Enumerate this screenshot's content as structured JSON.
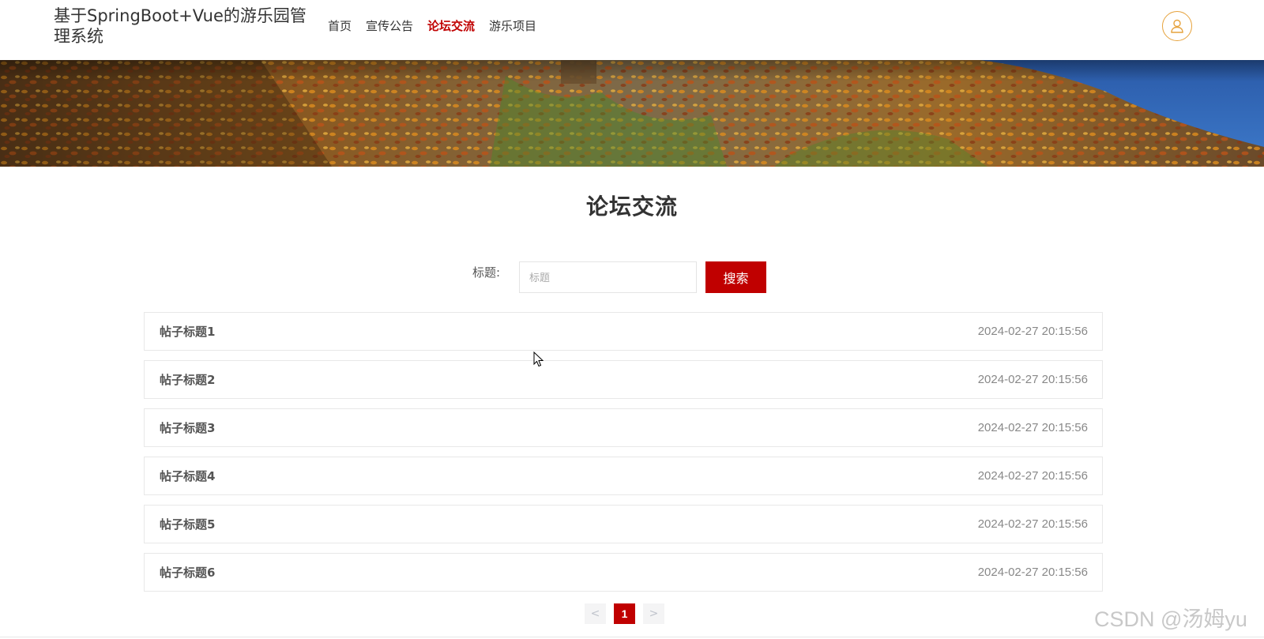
{
  "header": {
    "site_title": "基于SpringBoot+Vue的游乐园管理系统",
    "nav": [
      {
        "label": "首页",
        "active": false
      },
      {
        "label": "宣传公告",
        "active": false
      },
      {
        "label": "论坛交流",
        "active": true
      },
      {
        "label": "游乐项目",
        "active": false
      }
    ],
    "avatar_icon": "user-icon",
    "accent_color": "#e6a23c"
  },
  "banner": {
    "image": "autumn-leaves-banner"
  },
  "page": {
    "title": "论坛交流"
  },
  "search": {
    "label": "标题:",
    "placeholder": "标题",
    "value": "",
    "button_label": "搜索"
  },
  "posts": [
    {
      "title": "帖子标题1",
      "time": "2024-02-27 20:15:56"
    },
    {
      "title": "帖子标题2",
      "time": "2024-02-27 20:15:56"
    },
    {
      "title": "帖子标题3",
      "time": "2024-02-27 20:15:56"
    },
    {
      "title": "帖子标题4",
      "time": "2024-02-27 20:15:56"
    },
    {
      "title": "帖子标题5",
      "time": "2024-02-27 20:15:56"
    },
    {
      "title": "帖子标题6",
      "time": "2024-02-27 20:15:56"
    }
  ],
  "pagination": {
    "prev": "<",
    "current": "1",
    "next": ">"
  },
  "watermark": "CSDN @汤姆yu",
  "colors": {
    "brand": "#c00000"
  }
}
